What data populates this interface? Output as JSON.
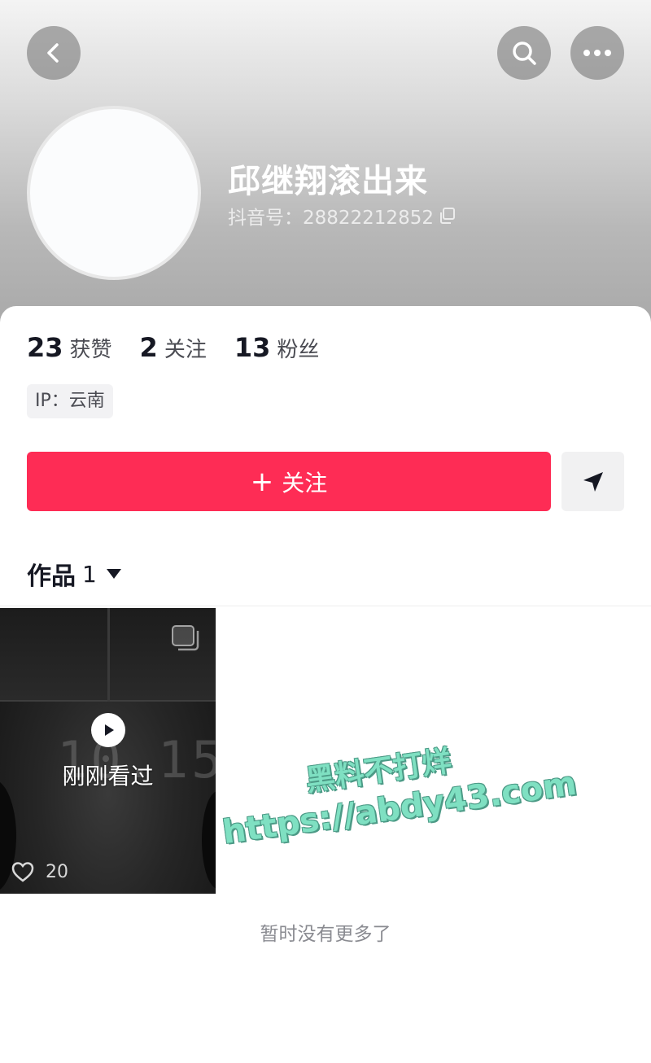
{
  "header": {
    "back_icon": "chevron-left-icon",
    "search_icon": "search-icon",
    "more_icon": "more-dots-icon"
  },
  "profile": {
    "nickname": "邱继翔滚出来",
    "account_label": "抖音号：28822212852",
    "copy_icon": "copy-icon"
  },
  "stats": [
    {
      "value": "23",
      "label": "获赞"
    },
    {
      "value": "2",
      "label": "关注"
    },
    {
      "value": "13",
      "label": "粉丝"
    }
  ],
  "ip_tag": "IP：云南",
  "actions": {
    "follow_plus": "+",
    "follow_label": "关注",
    "share_icon": "send-icon",
    "follow_color": "#fe2c55"
  },
  "works_tab": {
    "label": "作品",
    "count": "1"
  },
  "video": {
    "overlay_text": "刚刚看过",
    "likes": "20",
    "digits_bg": "10.15."
  },
  "watermark": {
    "line1": "黑料不打烊",
    "line2": "https://abdy43.com"
  },
  "footer": {
    "no_more": "暂时没有更多了"
  }
}
